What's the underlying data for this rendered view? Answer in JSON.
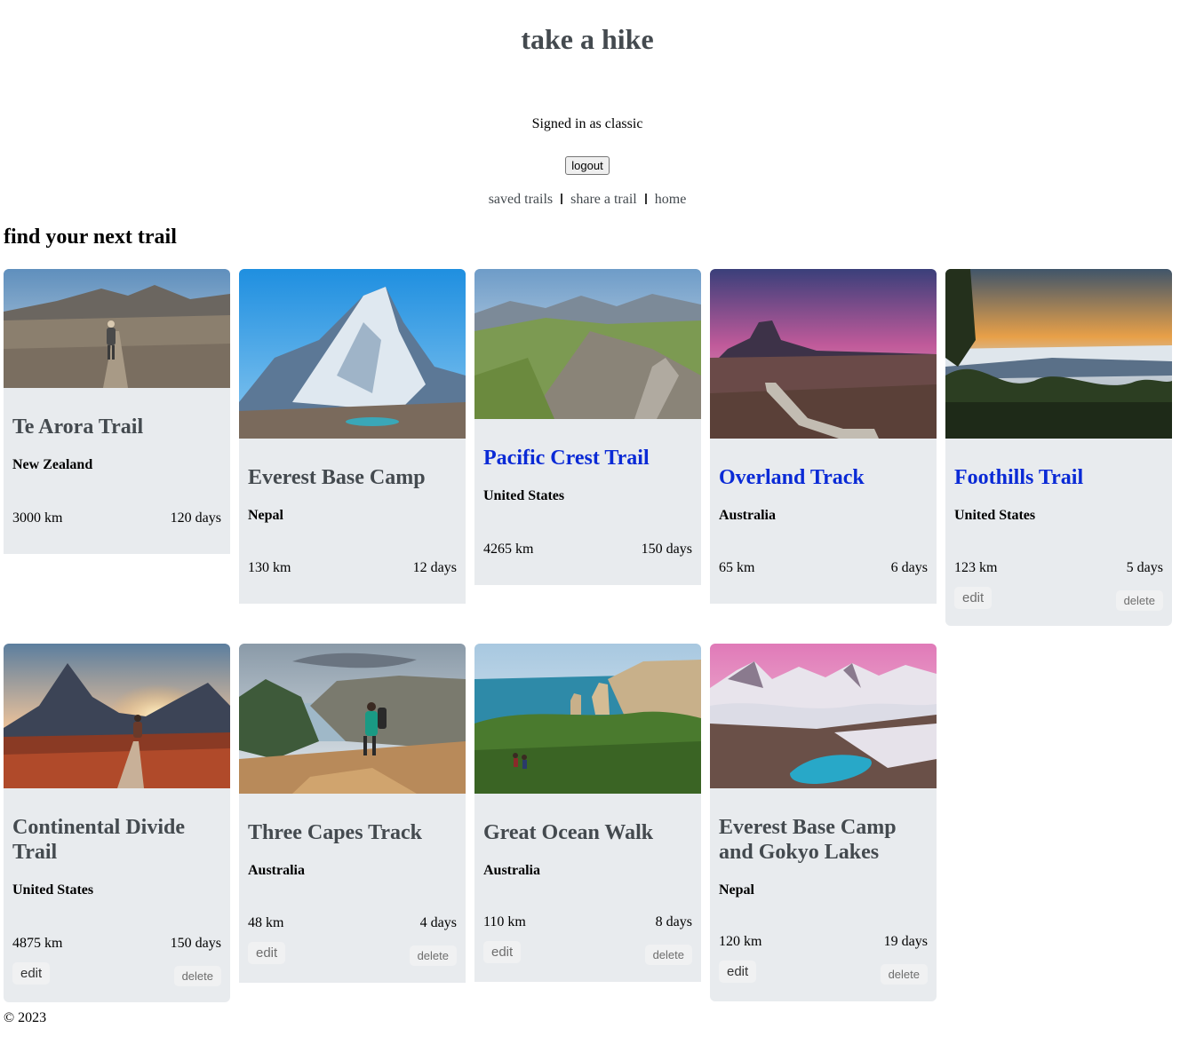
{
  "header": {
    "title": "take a hike",
    "signed_in_text": "Signed in as classic",
    "logout_label": "logout"
  },
  "nav": {
    "items": [
      {
        "label": "saved trails"
      },
      {
        "label": "share a trail"
      },
      {
        "label": "home"
      }
    ]
  },
  "main": {
    "heading": "find your next trail",
    "trails": [
      {
        "name": "Te Arora Trail",
        "country": "New Zealand",
        "distance": "3000 km",
        "duration": "120 days"
      },
      {
        "name": "Everest Base Camp",
        "country": "Nepal",
        "distance": "130 km",
        "duration": "12 days"
      },
      {
        "name": "Pacific Crest Trail",
        "country": "United States",
        "distance": "4265 km",
        "duration": "150 days",
        "link_color": "#0a2ad6"
      },
      {
        "name": "Overland Track",
        "country": "Australia",
        "distance": "65 km",
        "duration": "6 days",
        "link_color": "#0a2ad6"
      },
      {
        "name": "Foothills Trail",
        "country": "United States",
        "distance": "123 km",
        "duration": "5 days",
        "link_color": "#0a2ad6",
        "edit_label": "edit",
        "delete_label": "delete"
      },
      {
        "name": "Continental Divide Trail",
        "country": "United States",
        "distance": "4875 km",
        "duration": "150 days",
        "edit_label": "edit",
        "delete_label": "delete"
      },
      {
        "name": "Three Capes Track",
        "country": "Australia",
        "distance": "48 km",
        "duration": "4 days",
        "edit_label": "edit",
        "delete_label": "delete"
      },
      {
        "name": "Great Ocean Walk",
        "country": "Australia",
        "distance": "110 km",
        "duration": "8 days",
        "edit_label": "edit",
        "delete_label": "delete"
      },
      {
        "name": "Everest Base Camp and Gokyo Lakes",
        "country": "Nepal",
        "distance": "120 km",
        "duration": "19 days",
        "edit_label": "edit",
        "delete_label": "delete"
      }
    ]
  },
  "footer": {
    "copyright": "© 2023"
  }
}
